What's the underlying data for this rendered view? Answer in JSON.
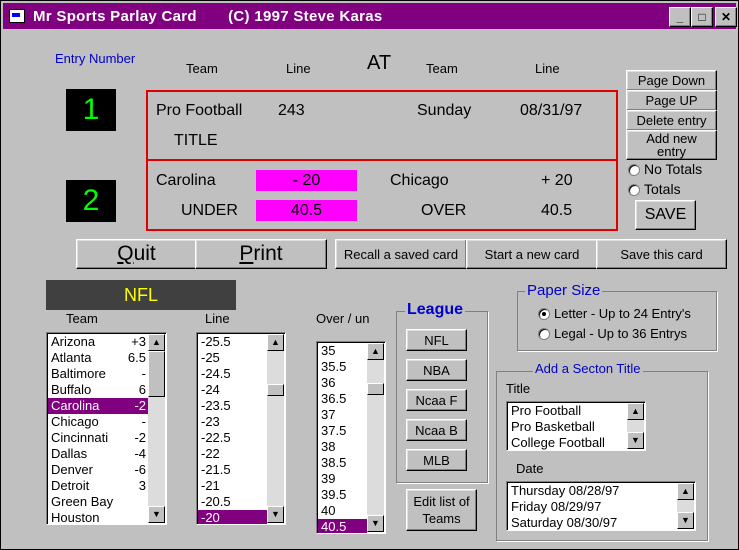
{
  "window": {
    "title": "Mr Sports Parlay Card       (C) 1997 Steve Karas"
  },
  "header": {
    "entry_number": "Entry Number",
    "team1": "Team",
    "line1": "Line",
    "at": "AT",
    "team2": "Team",
    "line2": "Line"
  },
  "entries": [
    {
      "number": "1",
      "row1": {
        "a": "Pro Football",
        "b": "243",
        "c": "Sunday",
        "d": "08/31/97"
      },
      "row2": {
        "a": "TITLE"
      }
    },
    {
      "number": "2",
      "row1": {
        "a": "Carolina",
        "b": "- 20",
        "c": "Chicago",
        "d": "+ 20"
      },
      "row2": {
        "a": "UNDER",
        "b": "40.5",
        "c": "OVER",
        "d": "40.5"
      }
    }
  ],
  "side_buttons": {
    "page_down": "Page Down",
    "page_up": "Page UP",
    "delete": "Delete entry",
    "add_new": "Add new entry"
  },
  "totals": {
    "no_totals": "No Totals",
    "totals": "Totals",
    "save": "SAVE"
  },
  "bottom_buttons": {
    "quit_q": "Q",
    "quit_rest": "uit",
    "print_p": "P",
    "print_rest": "rint",
    "recall": "Recall a saved card",
    "start_new": "Start a new card",
    "save_card": "Save this card"
  },
  "league_display": "NFL",
  "team_list": {
    "label": "Team",
    "items": [
      {
        "name": "Arizona",
        "val": "+3"
      },
      {
        "name": "Atlanta",
        "val": "6.5"
      },
      {
        "name": "Baltimore",
        "val": "-"
      },
      {
        "name": "Buffalo",
        "val": "6"
      },
      {
        "name": "Carolina",
        "val": "-2"
      },
      {
        "name": "Chicago",
        "val": "-"
      },
      {
        "name": "Cincinnati",
        "val": "-2"
      },
      {
        "name": "Dallas",
        "val": "-4"
      },
      {
        "name": "Denver",
        "val": "-6"
      },
      {
        "name": "Detroit",
        "val": "3"
      },
      {
        "name": "Green Bay",
        "val": ""
      },
      {
        "name": "Houston",
        "val": ""
      }
    ]
  },
  "line_list": {
    "label": "Line",
    "items": [
      "-25.5",
      "-25",
      "-24.5",
      "-24",
      "-23.5",
      "-23",
      "-22.5",
      "-22",
      "-21.5",
      "-21",
      "-20.5",
      "-20"
    ]
  },
  "overun_list": {
    "label": "Over / un",
    "items": [
      "35",
      "35.5",
      "36",
      "36.5",
      "37",
      "37.5",
      "38",
      "38.5",
      "39",
      "39.5",
      "40",
      "40.5"
    ]
  },
  "league": {
    "title": "League",
    "buttons": [
      "NFL",
      "NBA",
      "Ncaa F",
      "Ncaa B",
      "MLB"
    ]
  },
  "edit_teams": "Edit list of Teams",
  "paper_size": {
    "title": "Paper Size",
    "letter": "Letter - Up to 24 Entry's",
    "legal": "Legal - Up to 36 Entrys"
  },
  "section_title": {
    "title": "Add a Secton Title",
    "title_label": "Title",
    "titles": [
      "Pro Football",
      "Pro Basketball",
      "College Football"
    ],
    "date_label": "Date",
    "dates": [
      "Thursday 08/28/97",
      "Friday 08/29/97",
      "Saturday 08/30/97"
    ]
  }
}
